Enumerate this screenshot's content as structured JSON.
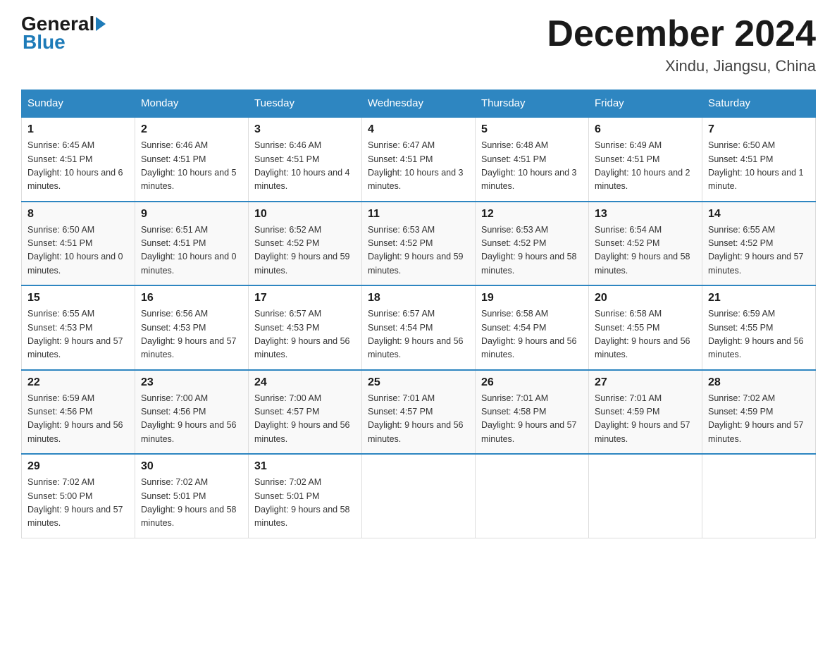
{
  "header": {
    "logo": {
      "part1": "General",
      "part2": "Blue"
    },
    "title": "December 2024",
    "location": "Xindu, Jiangsu, China"
  },
  "days_of_week": [
    "Sunday",
    "Monday",
    "Tuesday",
    "Wednesday",
    "Thursday",
    "Friday",
    "Saturday"
  ],
  "weeks": [
    [
      {
        "day": "1",
        "sunrise": "6:45 AM",
        "sunset": "4:51 PM",
        "daylight": "10 hours and 6 minutes."
      },
      {
        "day": "2",
        "sunrise": "6:46 AM",
        "sunset": "4:51 PM",
        "daylight": "10 hours and 5 minutes."
      },
      {
        "day": "3",
        "sunrise": "6:46 AM",
        "sunset": "4:51 PM",
        "daylight": "10 hours and 4 minutes."
      },
      {
        "day": "4",
        "sunrise": "6:47 AM",
        "sunset": "4:51 PM",
        "daylight": "10 hours and 3 minutes."
      },
      {
        "day": "5",
        "sunrise": "6:48 AM",
        "sunset": "4:51 PM",
        "daylight": "10 hours and 3 minutes."
      },
      {
        "day": "6",
        "sunrise": "6:49 AM",
        "sunset": "4:51 PM",
        "daylight": "10 hours and 2 minutes."
      },
      {
        "day": "7",
        "sunrise": "6:50 AM",
        "sunset": "4:51 PM",
        "daylight": "10 hours and 1 minute."
      }
    ],
    [
      {
        "day": "8",
        "sunrise": "6:50 AM",
        "sunset": "4:51 PM",
        "daylight": "10 hours and 0 minutes."
      },
      {
        "day": "9",
        "sunrise": "6:51 AM",
        "sunset": "4:51 PM",
        "daylight": "10 hours and 0 minutes."
      },
      {
        "day": "10",
        "sunrise": "6:52 AM",
        "sunset": "4:52 PM",
        "daylight": "9 hours and 59 minutes."
      },
      {
        "day": "11",
        "sunrise": "6:53 AM",
        "sunset": "4:52 PM",
        "daylight": "9 hours and 59 minutes."
      },
      {
        "day": "12",
        "sunrise": "6:53 AM",
        "sunset": "4:52 PM",
        "daylight": "9 hours and 58 minutes."
      },
      {
        "day": "13",
        "sunrise": "6:54 AM",
        "sunset": "4:52 PM",
        "daylight": "9 hours and 58 minutes."
      },
      {
        "day": "14",
        "sunrise": "6:55 AM",
        "sunset": "4:52 PM",
        "daylight": "9 hours and 57 minutes."
      }
    ],
    [
      {
        "day": "15",
        "sunrise": "6:55 AM",
        "sunset": "4:53 PM",
        "daylight": "9 hours and 57 minutes."
      },
      {
        "day": "16",
        "sunrise": "6:56 AM",
        "sunset": "4:53 PM",
        "daylight": "9 hours and 57 minutes."
      },
      {
        "day": "17",
        "sunrise": "6:57 AM",
        "sunset": "4:53 PM",
        "daylight": "9 hours and 56 minutes."
      },
      {
        "day": "18",
        "sunrise": "6:57 AM",
        "sunset": "4:54 PM",
        "daylight": "9 hours and 56 minutes."
      },
      {
        "day": "19",
        "sunrise": "6:58 AM",
        "sunset": "4:54 PM",
        "daylight": "9 hours and 56 minutes."
      },
      {
        "day": "20",
        "sunrise": "6:58 AM",
        "sunset": "4:55 PM",
        "daylight": "9 hours and 56 minutes."
      },
      {
        "day": "21",
        "sunrise": "6:59 AM",
        "sunset": "4:55 PM",
        "daylight": "9 hours and 56 minutes."
      }
    ],
    [
      {
        "day": "22",
        "sunrise": "6:59 AM",
        "sunset": "4:56 PM",
        "daylight": "9 hours and 56 minutes."
      },
      {
        "day": "23",
        "sunrise": "7:00 AM",
        "sunset": "4:56 PM",
        "daylight": "9 hours and 56 minutes."
      },
      {
        "day": "24",
        "sunrise": "7:00 AM",
        "sunset": "4:57 PM",
        "daylight": "9 hours and 56 minutes."
      },
      {
        "day": "25",
        "sunrise": "7:01 AM",
        "sunset": "4:57 PM",
        "daylight": "9 hours and 56 minutes."
      },
      {
        "day": "26",
        "sunrise": "7:01 AM",
        "sunset": "4:58 PM",
        "daylight": "9 hours and 57 minutes."
      },
      {
        "day": "27",
        "sunrise": "7:01 AM",
        "sunset": "4:59 PM",
        "daylight": "9 hours and 57 minutes."
      },
      {
        "day": "28",
        "sunrise": "7:02 AM",
        "sunset": "4:59 PM",
        "daylight": "9 hours and 57 minutes."
      }
    ],
    [
      {
        "day": "29",
        "sunrise": "7:02 AM",
        "sunset": "5:00 PM",
        "daylight": "9 hours and 57 minutes."
      },
      {
        "day": "30",
        "sunrise": "7:02 AM",
        "sunset": "5:01 PM",
        "daylight": "9 hours and 58 minutes."
      },
      {
        "day": "31",
        "sunrise": "7:02 AM",
        "sunset": "5:01 PM",
        "daylight": "9 hours and 58 minutes."
      },
      null,
      null,
      null,
      null
    ]
  ],
  "labels": {
    "sunrise_prefix": "Sunrise: ",
    "sunset_prefix": "Sunset: ",
    "daylight_prefix": "Daylight: "
  }
}
